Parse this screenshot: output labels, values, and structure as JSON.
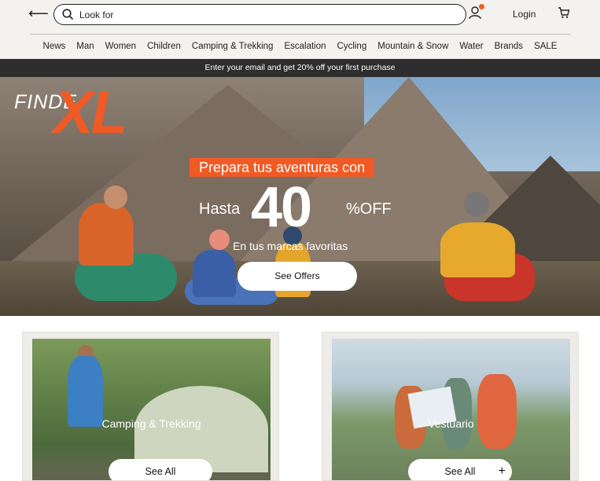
{
  "header": {
    "search_placeholder": "Look for",
    "login_label": "Login"
  },
  "nav": [
    "News",
    "Man",
    "Women",
    "Children",
    "Camping & Trekking",
    "Escalation",
    "Cycling",
    "Mountain & Snow",
    "Water",
    "Brands",
    "SALE"
  ],
  "promo": {
    "text": "Enter your email and get 20% off your first purchase"
  },
  "hero": {
    "logo_finde": "FINDE",
    "logo_xl": "XL",
    "tagline": "Prepara tus aventuras con",
    "hasta": "Hasta",
    "discount_number": "40",
    "discount_suffix": "%OFF",
    "subtitle": "En tus marcas favoritas",
    "cta": "See Offers"
  },
  "categories": [
    {
      "label": "Camping & Trekking",
      "button": "See All"
    },
    {
      "label": "Vestuario",
      "button": "See All"
    }
  ],
  "colors": {
    "accent": "#f15a24",
    "promo_bg": "#2d2d2d",
    "header_bg": "#f3f2ef"
  }
}
